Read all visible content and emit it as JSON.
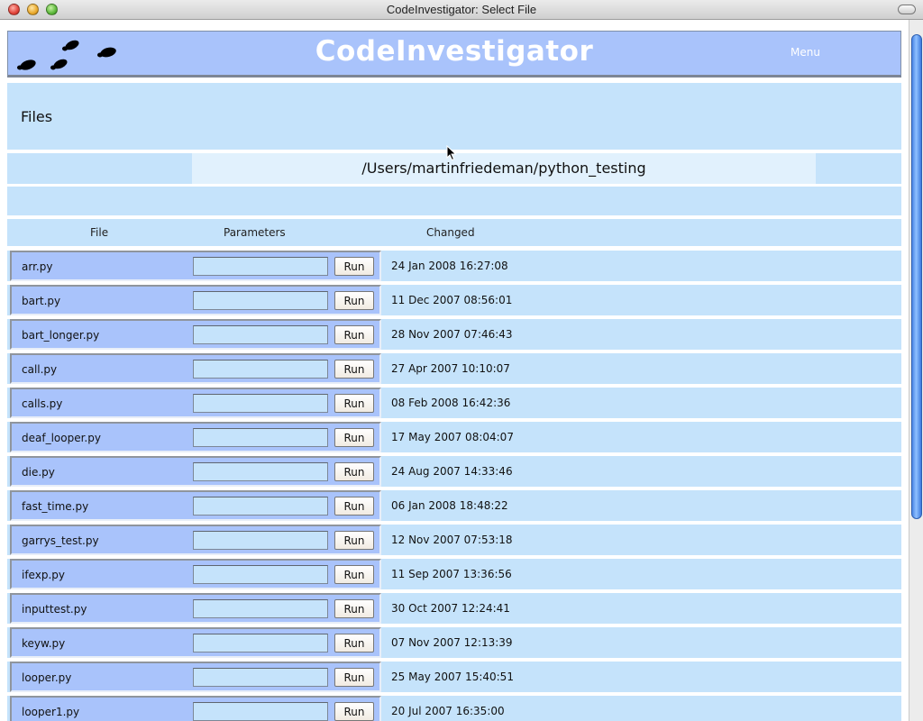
{
  "window": {
    "title": "CodeInvestigator: Select File"
  },
  "header": {
    "app_title": "CodeInvestigator",
    "menu_label": "Menu"
  },
  "files_section": {
    "label": "Files"
  },
  "path": "/Users/martinfriedeman/python_testing",
  "columns": {
    "file": "File",
    "parameters": "Parameters",
    "changed": "Changed"
  },
  "run_label": "Run",
  "rows": [
    {
      "file": "arr.py",
      "changed": "24 Jan 2008 16:27:08"
    },
    {
      "file": "bart.py",
      "changed": "11 Dec 2007 08:56:01"
    },
    {
      "file": "bart_longer.py",
      "changed": "28 Nov 2007 07:46:43"
    },
    {
      "file": "call.py",
      "changed": "27 Apr 2007 10:10:07"
    },
    {
      "file": "calls.py",
      "changed": "08 Feb 2008 16:42:36"
    },
    {
      "file": "deaf_looper.py",
      "changed": "17 May 2007 08:04:07"
    },
    {
      "file": "die.py",
      "changed": "24 Aug 2007 14:33:46"
    },
    {
      "file": "fast_time.py",
      "changed": "06 Jan 2008 18:48:22"
    },
    {
      "file": "garrys_test.py",
      "changed": "12 Nov 2007 07:53:18"
    },
    {
      "file": "ifexp.py",
      "changed": "11 Sep 2007 13:36:56"
    },
    {
      "file": "inputtest.py",
      "changed": "30 Oct 2007 12:24:41"
    },
    {
      "file": "keyw.py",
      "changed": "07 Nov 2007 12:13:39"
    },
    {
      "file": "looper.py",
      "changed": "25 May 2007 15:40:51"
    },
    {
      "file": "looper1.py",
      "changed": "20 Jul 2007 16:35:00"
    }
  ],
  "colors": {
    "header_bg": "#a9c3fb",
    "panel_bg": "#c5e3fb",
    "path_bg": "#e1f1fd"
  },
  "icons": {
    "logo": "footprints-icon",
    "cursor": "arrow-cursor-icon"
  }
}
